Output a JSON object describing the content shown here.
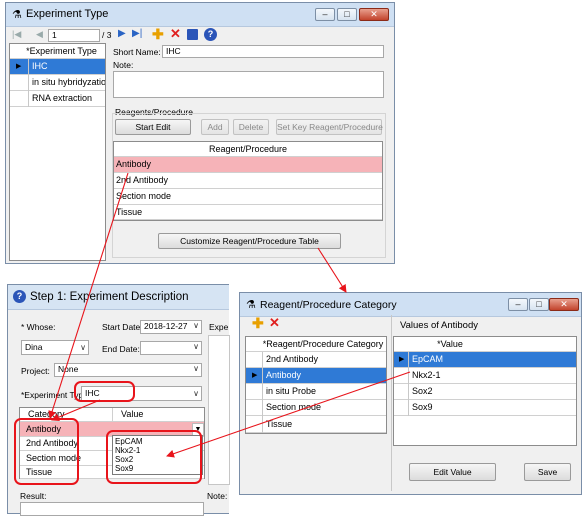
{
  "win1": {
    "title": "Experiment Type",
    "nav": {
      "current": "1",
      "total": "/ 3"
    },
    "list_header": "*Experiment Type",
    "list_items": [
      "IHC",
      "in situ hybridyzation",
      "RNA extraction"
    ],
    "short_name_label": "Short Name:",
    "short_name_value": "IHC",
    "note_label": "Note:",
    "reagents_group_label": "Reagents/Procedure",
    "buttons": {
      "start_edit": "Start Edit",
      "add": "Add",
      "delete": "Delete",
      "set_key": "Set Key Reagent/Procedure",
      "customize": "Customize Reagent/Procedure Table"
    },
    "table_header": "Reagent/Procedure",
    "table_rows": [
      "Antibody",
      "2nd Antibody",
      "Section mode",
      "Tissue"
    ]
  },
  "win2": {
    "title": "Step 1: Experiment Description",
    "whose_label": "* Whose:",
    "whose_value": "Dina",
    "start_date_label": "Start Date:",
    "start_date_value": "2018-12-27",
    "end_date_label": "End Date:",
    "project_label": "Project:",
    "project_value": "None",
    "exp_type_label": "*Experiment Typ",
    "exp_type_value": "IHC",
    "exp_cut": "Expe",
    "grid_headers": [
      "Category",
      "Value"
    ],
    "grid_rows": [
      "Antibody",
      "2nd Antibody",
      "Section mode",
      "Tissue"
    ],
    "dropdown_options": [
      "EpCAM",
      "Nkx2-1",
      "Sox2",
      "Sox9"
    ],
    "result_label": "Result:",
    "note_label": "Note:"
  },
  "win3": {
    "title": "Reagent/Procedure Category",
    "values_title": "Values of Antibody",
    "cat_header": "*Reagent/Procedure Category",
    "categories": [
      "2nd Antibody",
      "Antibody",
      "in situ Probe",
      "Section mode",
      "Tissue"
    ],
    "val_header": "*Value",
    "values": [
      "EpCAM",
      "Nkx2-1",
      "Sox2",
      "Sox9"
    ],
    "edit_value": "Edit Value",
    "save": "Save"
  },
  "colors": {
    "selection_red": "#f6b3b8",
    "selection_blue": "#2f7ad6",
    "annotation": "#e8141b"
  }
}
